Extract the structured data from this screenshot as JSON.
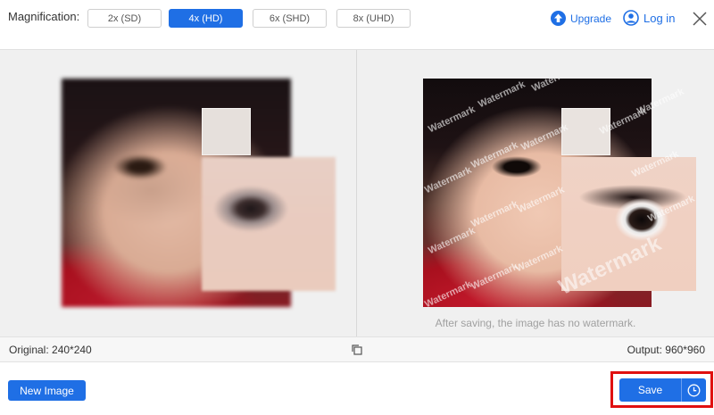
{
  "topbar": {
    "magnification_label": "Magnification:",
    "options": [
      {
        "label": "2x (SD)",
        "active": false
      },
      {
        "label": "4x (HD)",
        "active": true
      },
      {
        "label": "6x (SHD)",
        "active": false
      },
      {
        "label": "8x (UHD)",
        "active": false
      }
    ],
    "upgrade_label": "Upgrade",
    "login_label": "Log in"
  },
  "preview": {
    "watermark_text": "Watermark",
    "note": "After saving, the image has no watermark."
  },
  "info": {
    "original": "Original: 240*240",
    "output": "Output: 960*960"
  },
  "actions": {
    "new_image_label": "New Image",
    "save_label": "Save"
  },
  "colors": {
    "accent": "#1f6fe5",
    "highlight": "#e01010"
  }
}
